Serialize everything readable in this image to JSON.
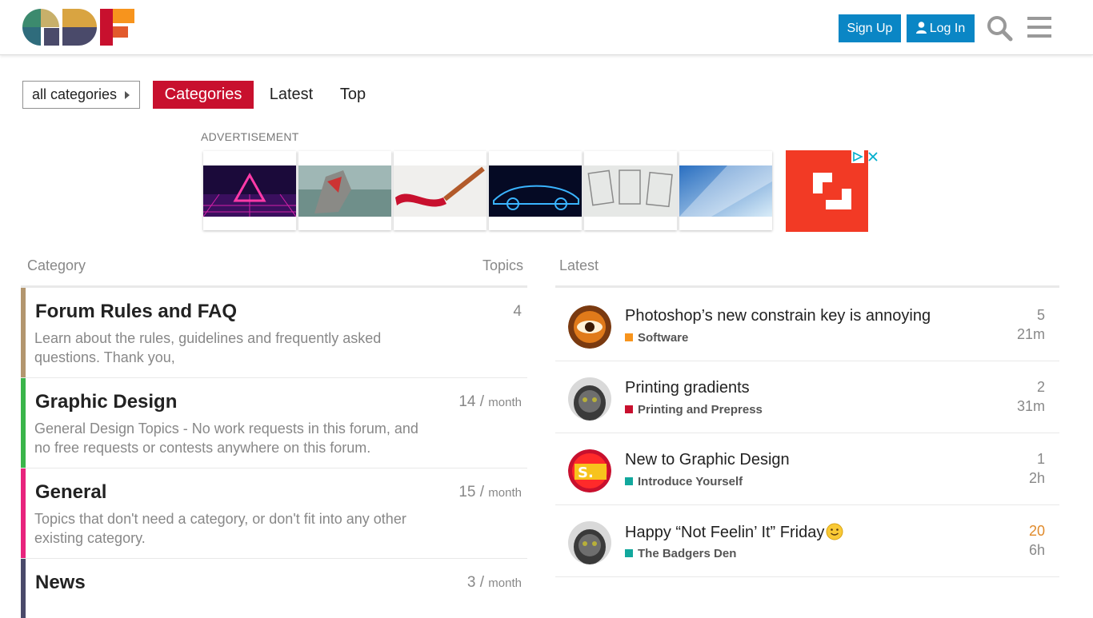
{
  "header": {
    "logo_alt": "GDF",
    "signup_label": "Sign Up",
    "login_label": "Log In",
    "search_icon": "search-icon",
    "menu_icon": "hamburger-menu-icon"
  },
  "nav": {
    "dropdown_label": "all categories",
    "tabs": [
      {
        "label": "Categories",
        "active": true
      },
      {
        "label": "Latest",
        "active": false
      },
      {
        "label": "Top",
        "active": false
      }
    ]
  },
  "ad": {
    "label": "ADVERTISEMENT"
  },
  "table": {
    "col_category": "Category",
    "col_topics": "Topics",
    "col_latest": "Latest"
  },
  "categories": [
    {
      "name": "Forum Rules and FAQ",
      "description": "Learn about the rules, guidelines and frequently asked questions. Thank you,",
      "count": "4",
      "per": "",
      "color": "#b3966e"
    },
    {
      "name": "Graphic Design",
      "description": "General Design Topics - No work requests in this forum, and no free requests or contests anywhere on this forum.",
      "count": "14",
      "per": "month",
      "color": "#3ab54a"
    },
    {
      "name": "General",
      "description": "Topics that don't need a category, or don't fit into any other existing category.",
      "count": "15",
      "per": "month",
      "color": "#e8247d"
    },
    {
      "name": "News",
      "description": "",
      "count": "3",
      "per": "month",
      "color": "#4a4a6a"
    }
  ],
  "topics": [
    {
      "title": "Photoshop’s new constrain key is annoying",
      "category": "Software",
      "cat_color": "#f7941d",
      "replies": "5",
      "age": "21m",
      "hot": false
    },
    {
      "title": "Printing gradients",
      "category": "Printing and Prepress",
      "cat_color": "#c8102e",
      "replies": "2",
      "age": "31m",
      "hot": false
    },
    {
      "title": "New to Graphic Design",
      "category": "Introduce Yourself",
      "cat_color": "#12a89d",
      "replies": "1",
      "age": "2h",
      "hot": false
    },
    {
      "title": "Happy “Not Feelin’ It” Friday",
      "category": "The Badgers Den",
      "cat_color": "#12a89d",
      "replies": "20",
      "age": "6h",
      "hot": true
    }
  ],
  "colors": {
    "brand_red": "#c8102e",
    "button_blue": "#0a86c5",
    "hot_count": "#e08a2b"
  }
}
